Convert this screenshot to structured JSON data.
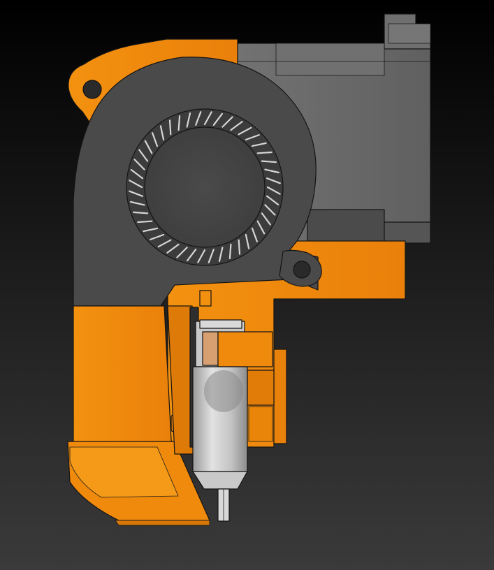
{
  "colors": {
    "background_top": "#000000",
    "background_bottom": "#3a3a3a",
    "orange": "#f0860a",
    "orange_light": "#f5960f",
    "orange_shadow": "#d87708",
    "motor_gray": "#6b6b6b",
    "motor_dark": "#4e4e4e",
    "fan_housing": "#4a4a4a",
    "fan_hub": "#454545",
    "heatsink_gray": "#b9b9b9",
    "nozzle_silver": "#cfcfcf"
  }
}
